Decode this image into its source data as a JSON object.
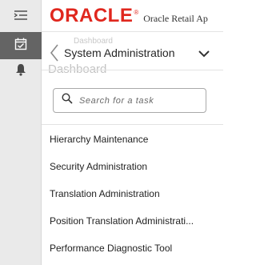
{
  "header": {
    "brand": "ORACLE",
    "app_title": "Oracle Retail Ap"
  },
  "rail": {
    "icons": [
      "menu-icon",
      "tasks-icon",
      "bell-icon"
    ]
  },
  "background": {
    "breadcrumb_ghost": "Dashboard",
    "title_ghost": "Dashboard"
  },
  "section": {
    "title": "System Administration"
  },
  "search": {
    "placeholder": "Search for a task",
    "value": ""
  },
  "tasks": [
    {
      "label": "Hierarchy Maintenance"
    },
    {
      "label": "Security Administration"
    },
    {
      "label": "Translation Administration"
    },
    {
      "label": "Position Translation Administrati..."
    },
    {
      "label": "Performance Diagnostic Tool"
    }
  ],
  "colors": {
    "brand_red": "#e0271e",
    "rail_bg": "#eaeaea",
    "rail_active": "#646464"
  }
}
